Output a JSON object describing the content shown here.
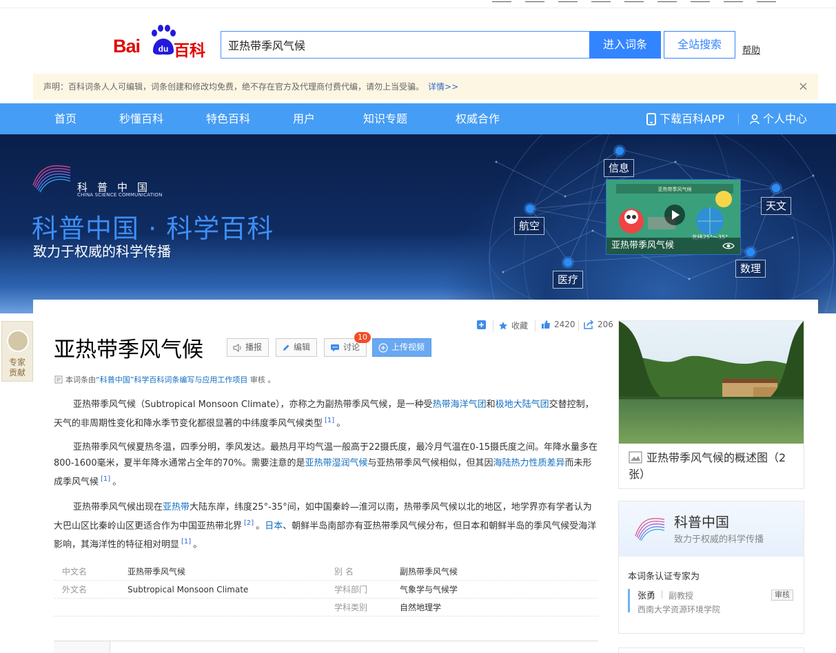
{
  "header": {
    "logo_bai": "Bai",
    "logo_du": "du",
    "logo_baike": "百科",
    "search_value": "亚热带季风气候",
    "enter_button": "进入词条",
    "site_search_button": "全站搜索",
    "help_link": "帮助"
  },
  "notice": {
    "text": "声明：百科词条人人可编辑，词条创建和修改均免费，绝不存在官方及代理商付费代编，请勿上当受骗。",
    "more_link": "详情>>",
    "close": "×"
  },
  "nav": {
    "items": [
      "首页",
      "秒懂百科",
      "特色百科",
      "用户",
      "知识专题",
      "权威合作"
    ],
    "download_app": "下载百科APP",
    "personal_center": "个人中心"
  },
  "banner": {
    "brand_cn": "科普中国",
    "brand_en": "CHINA SCIENCE COMMUNICATION",
    "title": "科普中国 · 科学百科",
    "subtitle": "致力于权威的科学传播",
    "tags": [
      "信息",
      "天文",
      "航空",
      "医疗",
      "数理"
    ],
    "video_caption": "亚热带季风气候",
    "video_inner_title": "亚热带季风气候",
    "video_inner_label": "北纬25°～35°"
  },
  "side_tab": {
    "label_line1": "专家",
    "label_line2": "贡献"
  },
  "entry": {
    "title": "亚热带季风气候",
    "tools": {
      "broadcast": "播报",
      "edit": "编辑",
      "discuss": "讨论",
      "discuss_count": "10",
      "upload_video": "上传视频"
    },
    "stats": {
      "collect": "收藏",
      "likes": "2420",
      "shares": "206"
    },
    "review": {
      "prefix": "本词条由",
      "org": "“科普中国”科学百科词条编写与应用工作项目",
      "suffix": " 审核 。"
    },
    "paragraphs": {
      "p1": {
        "a": "亚热带季风气候（Subtropical Monsoon Climate），亦称之为副热带季风气候，是一种受",
        "link1": "热带海洋气团",
        "b": "和",
        "link2": "极地大陆气团",
        "c": "交替控制，天气的非周期性变化和降水季节变化都很显著的中纬度季风气候类型",
        "ref": "[1]",
        "d": "。"
      },
      "p2": {
        "a": "亚热带季风气候夏热冬温，四季分明，季风发达。最热月平均气温一般高于22摄氏度，最冷月气温在0-15摄氏度之间。年降水量多在800-1600毫米，夏半年降水通常占全年的70%。需要注意的是",
        "link1": "亚热带湿润气候",
        "b": "与亚热带季风气候相似，但其因",
        "link2": "海陆热力性质差异",
        "c": "而未形成季风气候",
        "ref": "[1]",
        "d": "。"
      },
      "p3": {
        "a": "亚热带季风气候出现在",
        "link1": "亚热带",
        "b": "大陆东岸，纬度25°-35°间，如中国秦岭—淮河以南，热带季风气候以北的地区，地学界亦有学者认为大巴山区比秦岭山区更适合作为中国亚热带北界",
        "ref1": "[2]",
        "c": "。",
        "link2": "日本",
        "d": "、朝鲜半岛南部亦有亚热带季风气候分布，但日本和朝鲜半岛的季风气候受海洋影响，其海洋性的特征相对明显",
        "ref2": "[1]",
        "e": "。"
      }
    },
    "basic_info": [
      {
        "k1": "中文名",
        "v1": "亚热带季风气候",
        "k2": "别    名",
        "v2": "副热带季风气候"
      },
      {
        "k1": "外文名",
        "v1": "Subtropical Monsoon Climate",
        "k2": "学科部门",
        "v2": "气象学与气候学"
      },
      {
        "k1": "",
        "v1": "",
        "k2": "学科类别",
        "v2": "自然地理学"
      }
    ]
  },
  "album": {
    "caption": "亚热带季风气候的概述图（2张）"
  },
  "kepu_box": {
    "title": "科普中国",
    "subtitle": "致力于权威的科学传播",
    "expert_title": "本词条认证专家为",
    "expert_name": "张勇",
    "expert_rank": "副教授",
    "expert_school": "西南大学资源环境学院",
    "audit": "审核"
  },
  "colors": {
    "nav_blue": "#459df5",
    "baidu_red": "#e10602",
    "link_blue": "#136ec2",
    "button_blue": "#3385ff"
  }
}
